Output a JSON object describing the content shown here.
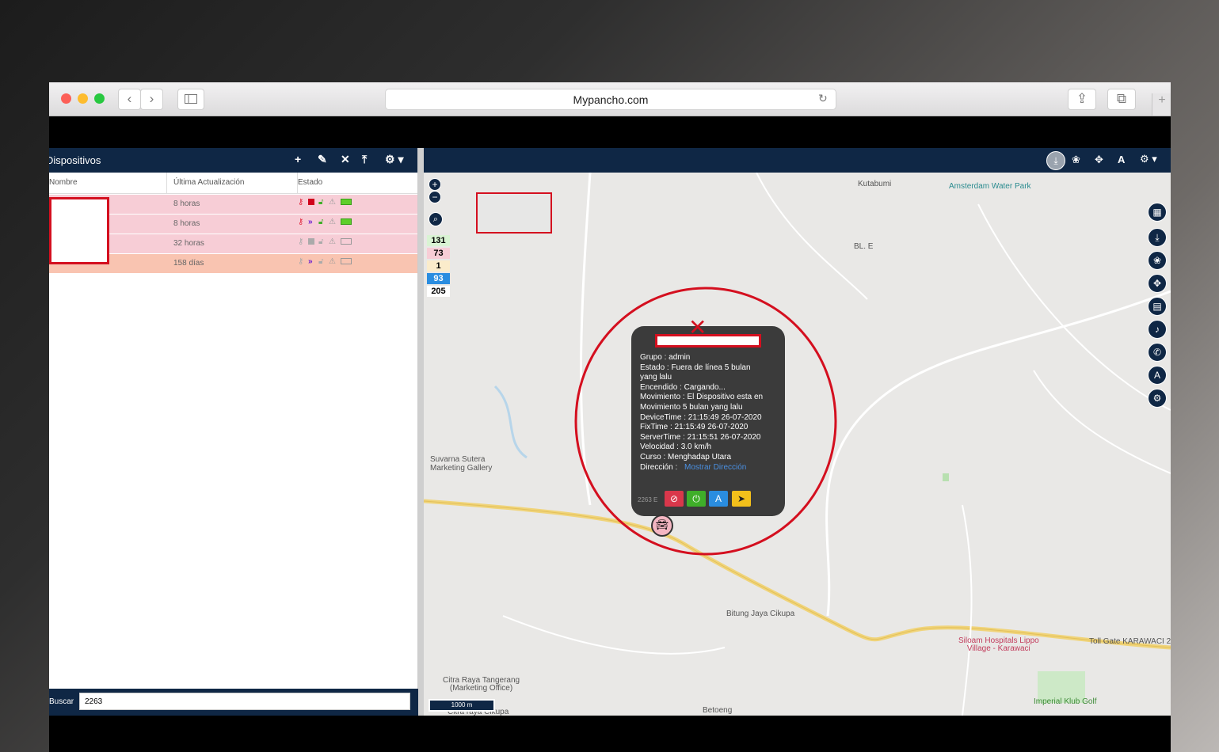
{
  "browser": {
    "url": "Mypancho.com"
  },
  "panel": {
    "title": "Dispositivos",
    "columns": [
      "Nombre",
      "Última Actualización",
      "Estado"
    ],
    "rows": [
      {
        "time": "8 horas",
        "bg": "#f7cdd6"
      },
      {
        "time": "8 horas",
        "bg": "#f7cdd6"
      },
      {
        "time": "32 horas",
        "bg": "#f7cdd6"
      },
      {
        "time": "158 días",
        "bg": "#f9c4b1"
      }
    ],
    "search_label": "Buscar",
    "search_value": "2263"
  },
  "counters": [
    {
      "value": "131",
      "bg": "#d9f3d3"
    },
    {
      "value": "73",
      "bg": "#f7cdd6"
    },
    {
      "value": "1",
      "bg": "#fbeccb"
    },
    {
      "value": "93",
      "bg": "#2a8de0"
    },
    {
      "value": "205",
      "bg": "#ffffff"
    }
  ],
  "map_labels": {
    "kutabumi": "Kutabumi",
    "amsterdam": "Amsterdam Water Park",
    "ble": "BL. E",
    "suvarna": "Suvarna Sutera\nMarketing Gallery",
    "bitung": "Bitung Jaya Cikupa",
    "siloam": "Siloam Hospitals Lippo\nVillage - Karawaci",
    "tollgate": "Toll Gate KARAWACI 2",
    "citra": "Citra Raya Tangerang\n(Marketing Office)",
    "imperial": "Imperial Klub Golf",
    "betoeng": "Betoeng",
    "citra2": "Citra raya Cikupa",
    "scale": "1000 m",
    "marker_label": "2263 E"
  },
  "popup": {
    "lines": [
      "Grupo :    admin",
      "Estado :    Fuera de línea 5 bulan",
      "yang lalu",
      "Encendido :    Cargando...",
      "Movimiento :    El Dispositivo esta en",
      "Movimiento 5 bulan yang lalu",
      "DeviceTime :    21:15:49 26-07-2020",
      "FixTime :    21:15:49 26-07-2020",
      "ServerTime :    21:15:51 26-07-2020",
      "Velocidad :    3.0 km/h",
      "Curso :    Menghadap Utara",
      "Dirección :"
    ],
    "link": "Mostrar Dirección"
  }
}
